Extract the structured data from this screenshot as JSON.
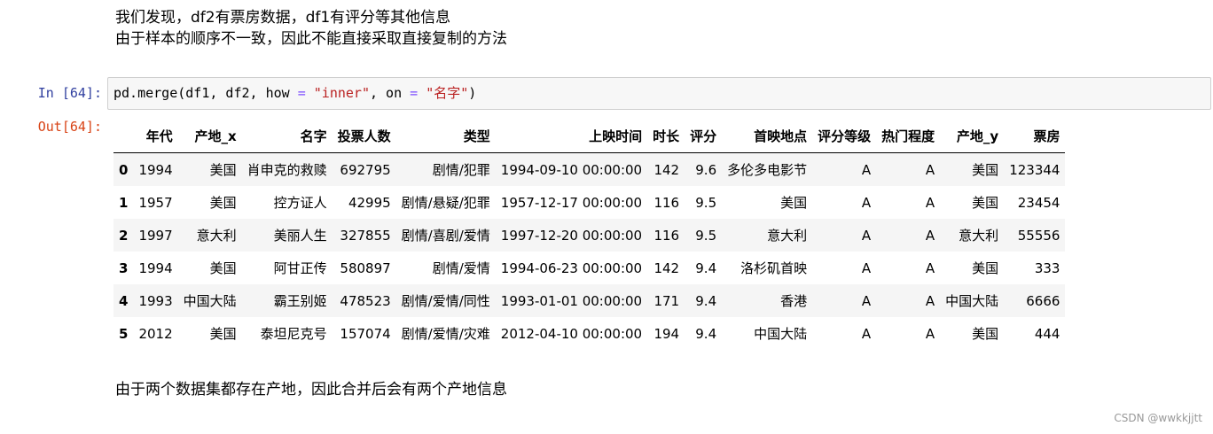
{
  "markdown_top": {
    "line1": "我们发现，df2有票房数据，df1有评分等其他信息",
    "line2": "由于样本的顺序不一致，因此不能直接采取直接复制的方法"
  },
  "code_cell": {
    "prompt_in": "In  [64]:",
    "code_prefix": "pd.merge(df1, df2, how ",
    "op1": "=",
    "str1": " \"inner\"",
    "code_mid": ", on ",
    "op2": "=",
    "str2": " \"名字\"",
    "code_suffix": ")"
  },
  "output": {
    "prompt_out": "Out[64]:",
    "columns": [
      "",
      "年代",
      "产地_x",
      "名字",
      "投票人数",
      "类型",
      "上映时间",
      "时长",
      "评分",
      "首映地点",
      "评分等级",
      "热门程度",
      "产地_y",
      "票房"
    ],
    "rows": [
      [
        "0",
        "1994",
        "美国",
        "肖申克的救赎",
        "692795",
        "剧情/犯罪",
        "1994-09-10 00:00:00",
        "142",
        "9.6",
        "多伦多电影节",
        "A",
        "A",
        "美国",
        "123344"
      ],
      [
        "1",
        "1957",
        "美国",
        "控方证人",
        "42995",
        "剧情/悬疑/犯罪",
        "1957-12-17 00:00:00",
        "116",
        "9.5",
        "美国",
        "A",
        "A",
        "美国",
        "23454"
      ],
      [
        "2",
        "1997",
        "意大利",
        "美丽人生",
        "327855",
        "剧情/喜剧/爱情",
        "1997-12-20 00:00:00",
        "116",
        "9.5",
        "意大利",
        "A",
        "A",
        "意大利",
        "55556"
      ],
      [
        "3",
        "1994",
        "美国",
        "阿甘正传",
        "580897",
        "剧情/爱情",
        "1994-06-23 00:00:00",
        "142",
        "9.4",
        "洛杉矶首映",
        "A",
        "A",
        "美国",
        "333"
      ],
      [
        "4",
        "1993",
        "中国大陆",
        "霸王别姬",
        "478523",
        "剧情/爱情/同性",
        "1993-01-01 00:00:00",
        "171",
        "9.4",
        "香港",
        "A",
        "A",
        "中国大陆",
        "6666"
      ],
      [
        "5",
        "2012",
        "美国",
        "泰坦尼克号",
        "157074",
        "剧情/爱情/灾难",
        "2012-04-10 00:00:00",
        "194",
        "9.4",
        "中国大陆",
        "A",
        "A",
        "美国",
        "444"
      ]
    ]
  },
  "markdown_bottom": {
    "line1": "由于两个数据集都存在产地，因此合并后会有两个产地信息"
  },
  "watermark": "CSDN @wwkkjjtt"
}
